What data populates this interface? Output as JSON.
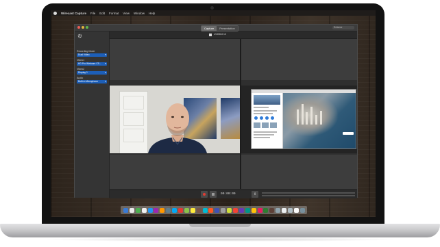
{
  "menubar": {
    "app_name": "Wirecast Capture",
    "menus": [
      "File",
      "Edit",
      "Format",
      "View",
      "Window",
      "Help"
    ]
  },
  "window": {
    "tabs": [
      {
        "label": "Capture",
        "active": true
      },
      {
        "label": "Presentation",
        "active": false
      }
    ],
    "search_placeholder": "Ecliame",
    "document_title": "Untitled 12"
  },
  "sidebar": {
    "settings_icon": "gear-icon",
    "fields": [
      {
        "label": "Recording Mode",
        "value": "Dual Video"
      },
      {
        "label": "Video1",
        "value": "HD Pro Webcam C9..."
      },
      {
        "label": "Video2",
        "value": "Display 1"
      },
      {
        "label": "Audio",
        "value": "Built-in Microphone"
      }
    ]
  },
  "transport": {
    "record_icon": "record-icon",
    "pause_icon": "pause-icon",
    "timer": "00:00:00",
    "volume_icon": "volume-icon"
  },
  "colors": {
    "accent": "#1d5fb8",
    "record": "#e23b32",
    "panel_bg": "#2f2f2f"
  },
  "dock": {
    "icons": [
      "#3a7bd5",
      "#e9e9e9",
      "#4caf50",
      "#f0f0f0",
      "#2196f3",
      "#9c27b0",
      "#ff9800",
      "#607d8b",
      "#03a9f4",
      "#e53935",
      "#8bc34a",
      "#ffeb3b",
      "#795548",
      "#00bcd4",
      "#ff5722",
      "#3f51b5",
      "#9e9e9e",
      "#cddc39",
      "#f44336",
      "#673ab7",
      "#009688",
      "#ffc107",
      "#e91e63",
      "#2e7d32",
      "#5d4037",
      "#90a4ae",
      "#eceff1",
      "#b0bec5",
      "#fafafa",
      "#78909c"
    ]
  }
}
